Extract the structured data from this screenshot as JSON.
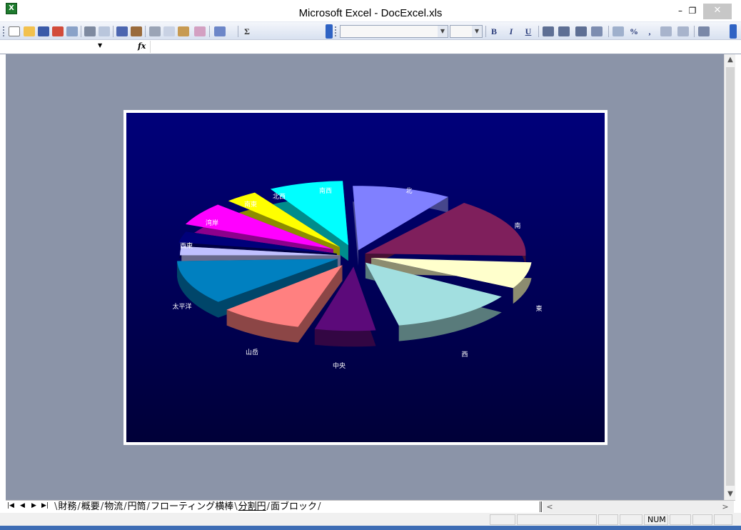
{
  "app": {
    "title": "Microsoft Excel - DocExcel.xls",
    "icon_label": "X"
  },
  "window_controls": {
    "minimize": "–",
    "restore": "❐",
    "close": "✕"
  },
  "toolbar": {
    "bold": "B",
    "italic": "I",
    "underline": "U",
    "percent": "%",
    "comma": ",",
    "sum": "Σ"
  },
  "formula_bar": {
    "name_box_value": "",
    "fx_label": "fx",
    "formula_value": ""
  },
  "chart_data": {
    "type": "pie",
    "style": "exploded-3d",
    "colors": {
      "background_top": "#00007a",
      "background_bottom": "#000038",
      "label": "#ffffff"
    },
    "slices": [
      {
        "label": "北",
        "color": "#8080ff"
      },
      {
        "label": "南",
        "color": "#7f1f5c"
      },
      {
        "label": "東",
        "color": "#ffffcc"
      },
      {
        "label": "西",
        "color": "#a2dfe0"
      },
      {
        "label": "中央",
        "color": "#5c0a7a"
      },
      {
        "label": "山岳",
        "color": "#ff8080"
      },
      {
        "label": "太平洋",
        "color": "#0080c0"
      },
      {
        "label": "西東",
        "color": "#c0c0ff"
      },
      {
        "label": "湾岸",
        "color": "#00007a"
      },
      {
        "label": "南東",
        "color": "#ff00ff"
      },
      {
        "label": "北西",
        "color": "#ffff00"
      },
      {
        "label": "南西",
        "color": "#00ffff"
      }
    ]
  },
  "sheet_tabs": {
    "nav": [
      "|◀",
      "◀",
      "▶",
      "▶|"
    ],
    "tabs": [
      {
        "label": "財務",
        "active": false
      },
      {
        "label": "概要",
        "active": false
      },
      {
        "label": "物流",
        "active": false
      },
      {
        "label": "円筒",
        "active": false
      },
      {
        "label": "フローティング横棒",
        "active": false
      },
      {
        "label": "分割円",
        "active": true
      },
      {
        "label": "面ブロック",
        "active": false
      }
    ]
  },
  "status_bar": {
    "num": "NUM"
  }
}
